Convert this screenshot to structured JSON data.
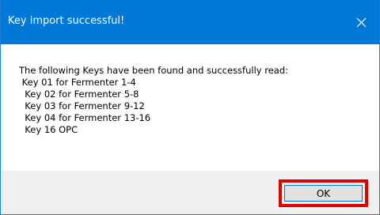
{
  "window": {
    "title": "Key import successful!",
    "accent_color": "#0078d7",
    "close_icon": "close-icon"
  },
  "message": {
    "heading": "The following Keys have been found and successfully read:",
    "keys": [
      " Key 01 for Fermenter 1-4",
      "  Key 02 for Fermenter 5-8",
      "  Key 03 for Fermenter 9-12",
      "  Key 04 for Fermenter 13-16",
      "  Key 16 OPC"
    ]
  },
  "footer": {
    "ok_label": "OK",
    "highlight_color": "#e00000"
  }
}
